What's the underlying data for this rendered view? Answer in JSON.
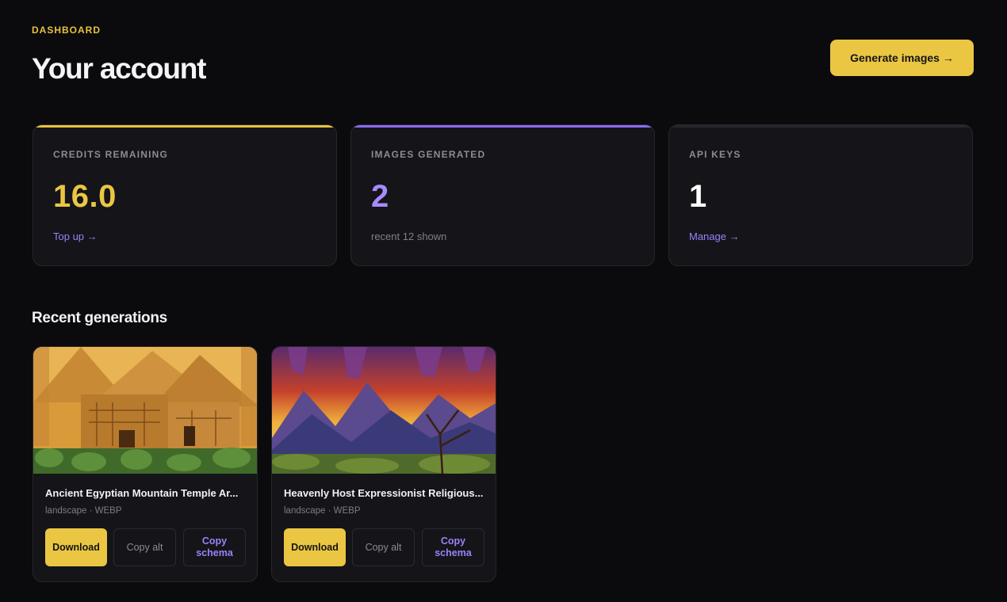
{
  "header": {
    "eyebrow": "DASHBOARD",
    "title": "Your account",
    "cta_label": "Generate images →"
  },
  "stats": [
    {
      "label": "CREDITS REMAINING",
      "value": "16.0",
      "link": "Top up →",
      "accent": "#e9c13f",
      "value_color": "#eac643"
    },
    {
      "label": "IMAGES GENERATED",
      "value": "2",
      "sub": "recent 12 shown",
      "accent": "#8b6cf6",
      "value_color": "#a78bfa"
    },
    {
      "label": "API KEYS",
      "value": "1",
      "link": "Manage →",
      "accent": "#26262d",
      "value_color": "#ffffff"
    }
  ],
  "recent": {
    "title": "Recent generations",
    "items": [
      {
        "name": "Ancient Egyptian Mountain Temple Ar...",
        "meta": "landscape · WEBP",
        "download": "Download",
        "copy_alt": "Copy alt",
        "copy_schema": "Copy schema",
        "thumb_icon": "egyptian-temple-thumbnail"
      },
      {
        "name": "Heavenly Host Expressionist Religious...",
        "meta": "landscape · WEBP",
        "download": "Download",
        "copy_alt": "Copy alt",
        "copy_schema": "Copy schema",
        "thumb_icon": "mountain-sunset-thumbnail"
      }
    ]
  },
  "colors": {
    "background": "#0b0b0d",
    "card": "#141419",
    "accent_yellow": "#eac643",
    "accent_purple": "#9b82f7"
  }
}
